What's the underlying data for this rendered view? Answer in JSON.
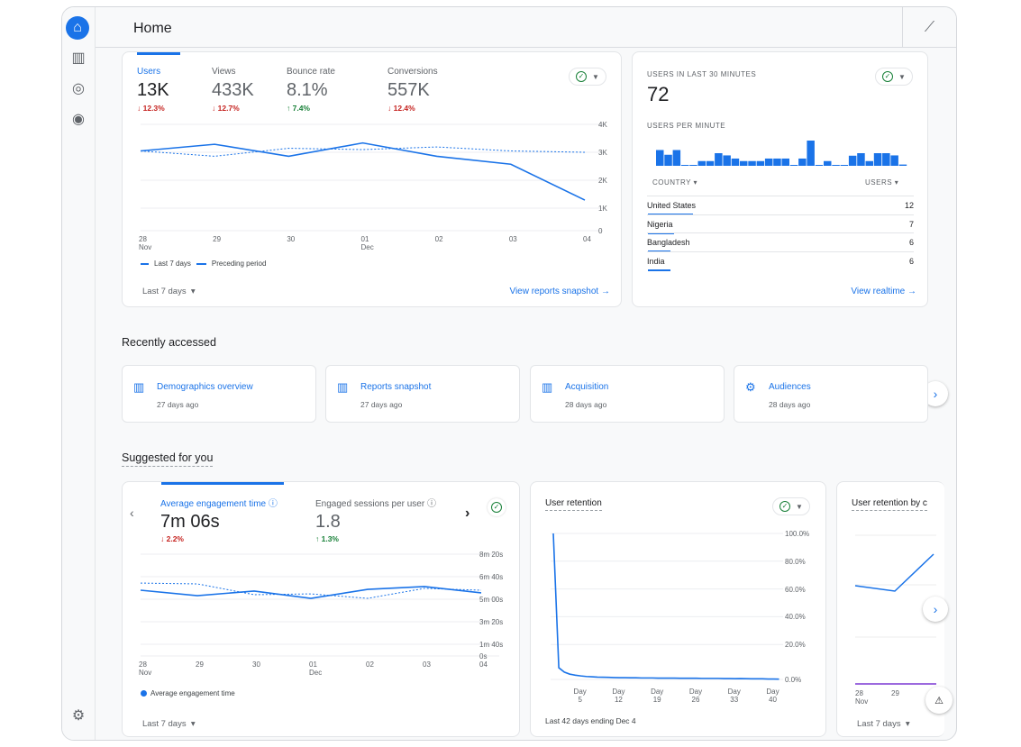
{
  "header": {
    "title": "Home",
    "insights_icon": "insights-icon"
  },
  "sidebar": {
    "items": [
      "home-icon",
      "reports-icon",
      "explore-icon",
      "advertising-icon"
    ],
    "settings": "gear-icon"
  },
  "overview": {
    "metrics": [
      {
        "label": "Users",
        "value": "13K",
        "change": "↓ 12.3%",
        "dir": "down"
      },
      {
        "label": "Views",
        "value": "433K",
        "change": "↓ 12.7%",
        "dir": "down"
      },
      {
        "label": "Bounce rate",
        "value": "8.1%",
        "change": "↑ 7.4%",
        "dir": "up"
      },
      {
        "label": "Conversions",
        "value": "557K",
        "change": "↓ 12.4%",
        "dir": "down"
      }
    ],
    "y_ticks": [
      "4K",
      "3K",
      "2K",
      "1K",
      "0"
    ],
    "x_ticks": [
      [
        "28",
        "Nov"
      ],
      [
        "29",
        ""
      ],
      [
        "30",
        ""
      ],
      [
        "01",
        "Dec"
      ],
      [
        "02",
        ""
      ],
      [
        "03",
        ""
      ],
      [
        "04",
        ""
      ]
    ],
    "series": {
      "current": [
        3000,
        3250,
        2800,
        3300,
        2800,
        2500,
        1150
      ],
      "previous": [
        3000,
        2800,
        3100,
        3050,
        3150,
        3000,
        2950
      ]
    },
    "legend": {
      "current": "Last 7 days",
      "previous": "Preceding period"
    },
    "range": "Last 7 days",
    "link": "View reports snapshot"
  },
  "realtime": {
    "title": "USERS IN LAST 30 MINUTES",
    "value": "72",
    "per_minute_label": "USERS PER MINUTE",
    "per_minute": [
      5,
      3.5,
      5,
      0.2,
      0.2,
      1.5,
      1.5,
      4,
      3.3,
      2.3,
      1.5,
      1.5,
      1.5,
      2.3,
      2.3,
      2.3,
      0.2,
      2.3,
      8,
      0.2,
      1.5,
      0.1,
      0.2,
      3.2,
      4,
      1.5,
      4,
      4,
      3.3,
      0.4
    ],
    "col_country": "COUNTRY",
    "col_users": "USERS",
    "rows": [
      {
        "country": "United States",
        "users": "12",
        "n": 12
      },
      {
        "country": "Nigeria",
        "users": "7",
        "n": 7
      },
      {
        "country": "Bangladesh",
        "users": "6",
        "n": 6
      },
      {
        "country": "India",
        "users": "6",
        "n": 6
      }
    ],
    "link": "View realtime"
  },
  "recent": {
    "title": "Recently accessed",
    "items": [
      {
        "name": "Demographics overview",
        "when": "27 days ago",
        "icon": "report-icon"
      },
      {
        "name": "Reports snapshot",
        "when": "27 days ago",
        "icon": "report-icon"
      },
      {
        "name": "Acquisition",
        "when": "28 days ago",
        "icon": "report-icon"
      },
      {
        "name": "Audiences",
        "when": "28 days ago",
        "icon": "gear-icon"
      }
    ]
  },
  "suggested": {
    "title": "Suggested for you",
    "engagement": {
      "metrics": [
        {
          "label": "Average engagement time",
          "value": "7m 06s",
          "change": "↓ 2.2%"
        },
        {
          "label": "Engaged sessions per user",
          "value": "1.8",
          "change": "↑ 1.3%"
        }
      ],
      "y_ticks": [
        "8m 20s",
        "6m 40s",
        "5m 00s",
        "3m 20s",
        "1m 40s",
        "0s"
      ],
      "x_ticks": [
        [
          "28",
          "Nov"
        ],
        [
          "29",
          ""
        ],
        [
          "30",
          ""
        ],
        [
          "01",
          "Dec"
        ],
        [
          "02",
          ""
        ],
        [
          "03",
          ""
        ],
        [
          "04",
          ""
        ]
      ],
      "series_seconds": {
        "current": [
          323,
          296,
          319,
          283,
          327,
          341,
          310
        ],
        "previous": [
          358,
          354,
          301,
          305,
          283,
          332,
          323
        ]
      },
      "legend": "Average engagement time",
      "range": "Last 7 days"
    },
    "retention": {
      "title": "User retention",
      "y_ticks": [
        "100.0%",
        "80.0%",
        "60.0%",
        "40.0%",
        "20.0%",
        "0.0%"
      ],
      "x_ticks": [
        [
          "Day",
          "5"
        ],
        [
          "Day",
          "12"
        ],
        [
          "Day",
          "19"
        ],
        [
          "Day",
          "26"
        ],
        [
          "Day",
          "33"
        ],
        [
          "Day",
          "40"
        ]
      ],
      "values_pct": [
        100,
        8,
        5,
        3.6,
        2.9,
        2.4,
        2,
        1.8,
        1.6,
        1.5,
        1.4,
        1.3,
        1.2,
        1.2,
        1.1,
        1.1,
        1,
        1,
        1,
        0.9,
        0.9,
        0.9,
        0.9,
        0.8,
        0.8,
        0.8,
        0.8,
        0.7,
        0.7,
        0.7,
        0.7,
        0.6,
        0.6,
        0.5,
        0.6,
        0.5,
        0.4,
        0.4,
        0.4,
        0.3,
        0.3,
        0.2
      ],
      "footer": "Last 42 days ending Dec 4"
    },
    "cohort": {
      "title": "User retention by c",
      "x_ticks": [
        [
          "28",
          "Nov"
        ],
        [
          "29",
          ""
        ]
      ],
      "range": "Last 7 days"
    }
  },
  "colors": {
    "accent": "#1a73e8",
    "down": "#c5221f",
    "up": "#188038"
  }
}
